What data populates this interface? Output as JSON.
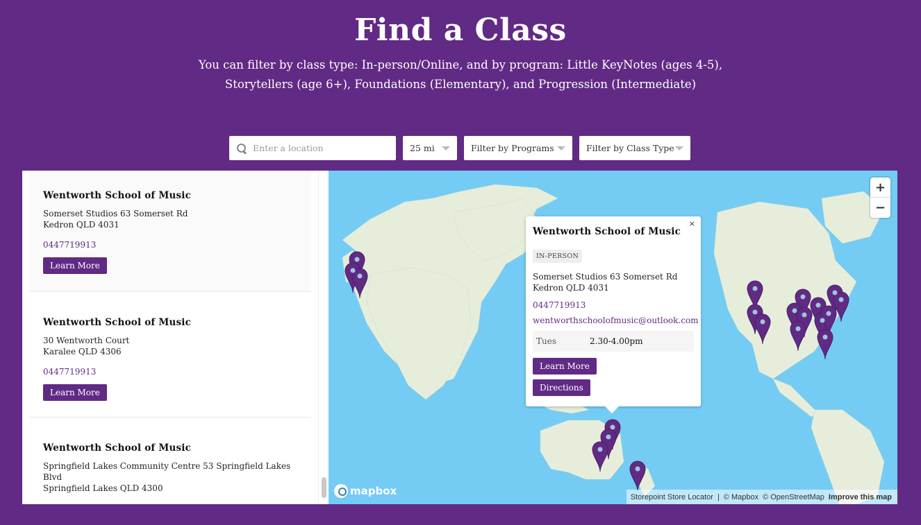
{
  "header": {
    "title": "Find a Class",
    "subtitle": "You can filter by class type: In-person/Online, and by program: Little KeyNotes (ages 4-5), Storytellers (age 6+), Foundations (Elementary), and Progression (Intermediate)"
  },
  "filters": {
    "search_placeholder": "Enter a location",
    "radius": "25 mi",
    "programs": "Filter by Programs",
    "class_type": "Filter by Class Type"
  },
  "list": [
    {
      "name": "Wentworth School of Music",
      "address_line1": "Somerset Studios 63 Somerset Rd",
      "address_line2": "Kedron QLD 4031",
      "phone": "0447719913",
      "button": "Learn More"
    },
    {
      "name": "Wentworth School of Music",
      "address_line1": "30 Wentworth Court",
      "address_line2": "Karalee QLD 4306",
      "phone": "0447719913",
      "button": "Learn More"
    },
    {
      "name": "Wentworth School of Music",
      "address_line1": "Springfield Lakes Community Centre  53 Springfield Lakes Blvd",
      "address_line2": "Springfield Lakes QLD 4300",
      "phone": "0447719913",
      "button": "Learn More"
    }
  ],
  "map": {
    "zoom_in": "+",
    "zoom_out": "−",
    "logo": "mapbox",
    "attribution": {
      "store_locator": "Storepoint Store Locator",
      "mapbox": "© Mapbox",
      "osm": "© OpenStreetMap",
      "improve": "Improve this map"
    },
    "pin_color": "#612a85"
  },
  "popup": {
    "close": "×",
    "name": "Wentworth School of Music",
    "badge": "IN-PERSON",
    "address_line1": "Somerset Studios 63 Somerset Rd",
    "address_line2": "Kedron QLD 4031",
    "phone": "0447719913",
    "email": "wentworthschoolofmusic@outlook.com",
    "hours_day": "Tues",
    "hours_time": "2.30-4.00pm",
    "learn_more": "Learn More",
    "directions": "Directions"
  },
  "colors": {
    "brand": "#612a85",
    "water": "#74ccf4",
    "land": "#e6eedb"
  }
}
